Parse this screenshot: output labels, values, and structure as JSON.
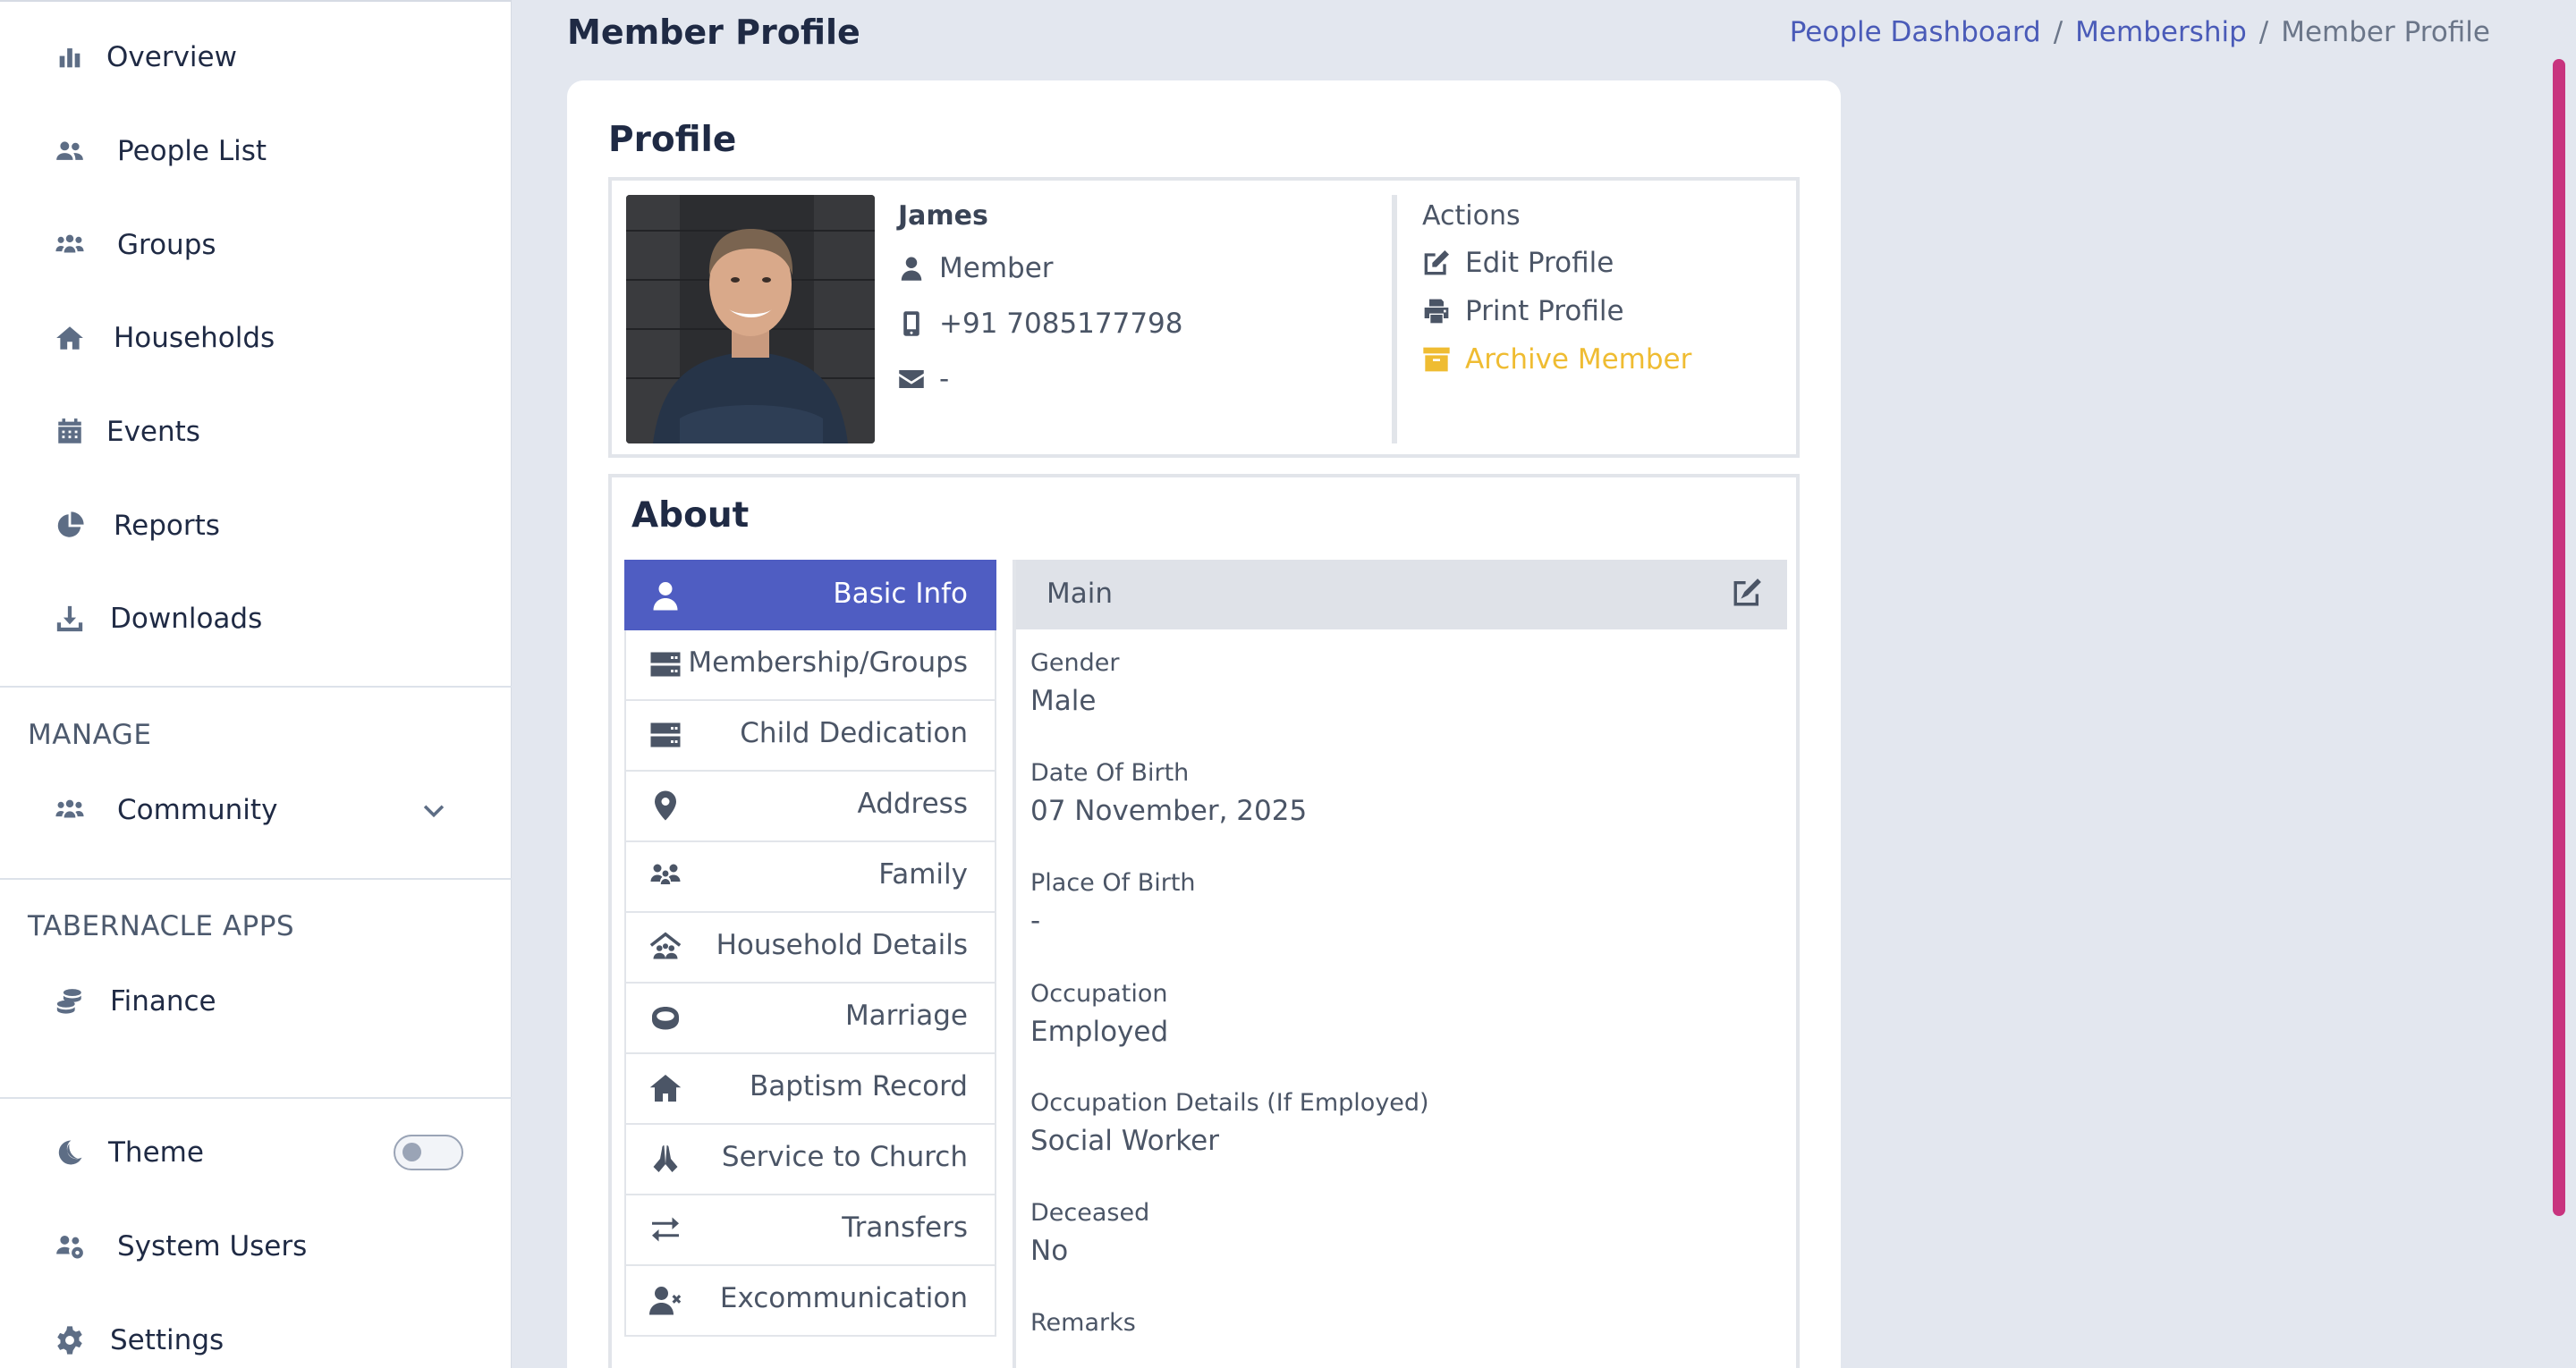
{
  "sidebar": {
    "items": [
      {
        "label": "Overview",
        "icon": "bar-chart-icon"
      },
      {
        "label": "People List",
        "icon": "users-icon"
      },
      {
        "label": "Groups",
        "icon": "people-group-icon"
      },
      {
        "label": "Households",
        "icon": "home-icon"
      },
      {
        "label": "Events",
        "icon": "calendar-icon"
      },
      {
        "label": "Reports",
        "icon": "pie-chart-icon"
      },
      {
        "label": "Downloads",
        "icon": "download-icon"
      }
    ],
    "manage_title": "MANAGE",
    "community_label": "Community",
    "apps_title": "TABERNACLE APPS",
    "finance_label": "Finance",
    "theme_label": "Theme",
    "theme_dark": false,
    "system_users_label": "System Users",
    "settings_label": "Settings"
  },
  "header": {
    "title": "Member Profile",
    "breadcrumb": [
      "People Dashboard",
      "Membership",
      "Member Profile"
    ],
    "breadcrumb_sep": "/"
  },
  "profile": {
    "card_title": "Profile",
    "name": "James",
    "role": "Member",
    "phone": "+91 7085177798",
    "email": "-",
    "actions_title": "Actions",
    "actions": {
      "edit": "Edit Profile",
      "print": "Print Profile",
      "archive": "Archive Member"
    }
  },
  "about": {
    "title": "About",
    "tabs": [
      {
        "label": "Basic Info",
        "icon": "user-icon",
        "active": true
      },
      {
        "label": "Membership/Groups",
        "icon": "server-icon"
      },
      {
        "label": "Child Dedication",
        "icon": "server-icon"
      },
      {
        "label": "Address",
        "icon": "map-pin-icon"
      },
      {
        "label": "Family",
        "icon": "family-icon"
      },
      {
        "label": "Household Details",
        "icon": "house-people-icon"
      },
      {
        "label": "Marriage",
        "icon": "ring-icon"
      },
      {
        "label": "Baptism Record",
        "icon": "home-icon"
      },
      {
        "label": "Service to Church",
        "icon": "praying-hands-icon"
      },
      {
        "label": "Transfers",
        "icon": "transfer-icon"
      },
      {
        "label": "Excommunication",
        "icon": "user-remove-icon"
      }
    ],
    "section_title": "Main",
    "fields": [
      {
        "label": "Gender",
        "value": "Male"
      },
      {
        "label": "Date Of Birth",
        "value": "07 November, 2025"
      },
      {
        "label": "Place Of Birth",
        "value": "-"
      },
      {
        "label": "Occupation",
        "value": "Employed"
      },
      {
        "label": "Occupation Details (If Employed)",
        "value": "Social Worker"
      },
      {
        "label": "Deceased",
        "value": "No"
      },
      {
        "label": "Remarks",
        "value": ""
      }
    ]
  },
  "colors": {
    "accent": "#4f5dc2",
    "archive": "#efbc32",
    "scrollbar": "#c8347e",
    "background": "#e3e7ef"
  }
}
